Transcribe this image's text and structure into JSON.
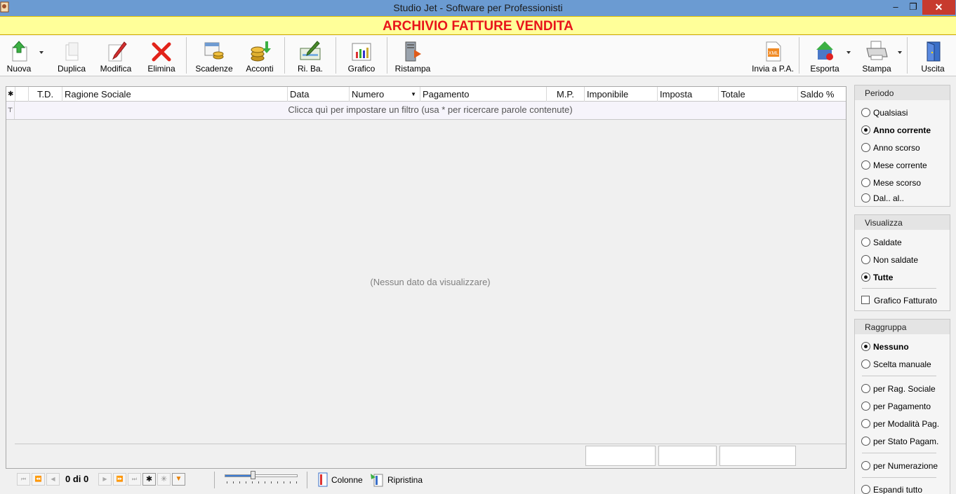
{
  "window": {
    "title": "Studio Jet - Software per Professionisti",
    "minimize": "‒",
    "maximize": "❐",
    "close": "✕"
  },
  "banner": {
    "title": "ARCHIVIO FATTURE VENDITA"
  },
  "toolbar": {
    "nuova": "Nuova",
    "duplica": "Duplica",
    "modifica": "Modifica",
    "elimina": "Elimina",
    "scadenze": "Scadenze",
    "acconti": "Acconti",
    "riba": "Ri. Ba.",
    "grafico": "Grafico",
    "ristampa": "Ristampa",
    "invia_pa": "Invia a P.A.",
    "esporta": "Esporta",
    "stampa": "Stampa",
    "uscita": "Uscita"
  },
  "grid": {
    "columns": {
      "star": "✱",
      "td": "T.D.",
      "ragione": "Ragione Sociale",
      "data": "Data",
      "numero": "Numero",
      "pagamento": "Pagamento",
      "mp": "M.P.",
      "imponibile": "Imponibile",
      "imposta": "Imposta",
      "totale": "Totale",
      "saldo": "Saldo %"
    },
    "filter_hint": "Clicca quì per impostare un filtro (usa * per ricercare parole contenute)",
    "empty": "(Nessun dato da visualizzare)"
  },
  "side": {
    "periodo": {
      "title": "Periodo",
      "options": [
        "Qualsiasi",
        "Anno corrente",
        "Anno scorso",
        "Mese corrente",
        "Mese scorso",
        "Dal.. al.."
      ],
      "selected": "Anno corrente"
    },
    "visualizza": {
      "title": "Visualizza",
      "options": [
        "Saldate",
        "Non saldate",
        "Tutte"
      ],
      "selected": "Tutte",
      "checkbox": "Grafico Fatturato",
      "checkbox_checked": false
    },
    "raggruppa": {
      "title": "Raggruppa",
      "options": [
        "Nessuno",
        "Scelta manuale",
        "per Rag. Sociale",
        "per Pagamento",
        "per Modalità Pag.",
        "per Stato Pagam.",
        "per Numerazione",
        "Espandi tutto"
      ],
      "selected": "Nessuno"
    }
  },
  "navbar": {
    "record": "0 di 0",
    "colonne": "Colonne",
    "ripristina": "Ripristina",
    "zoom_level": 0.4
  }
}
